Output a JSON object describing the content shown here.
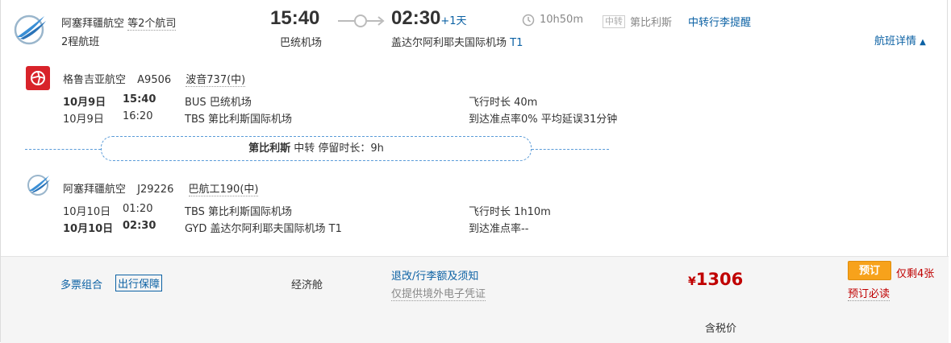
{
  "header": {
    "airline": "阿塞拜疆航空",
    "carriers_note": "等2个航司",
    "trip_type": "2程航班",
    "dep_time": "15:40",
    "dep_airport": "巴统机场",
    "arr_time": "02:30",
    "arr_day_offset": "+1天",
    "arr_airport": "盖达尔阿利耶夫国际机场",
    "arr_terminal": "T1",
    "duration": "10h50m",
    "transfer_badge": "中转",
    "transfer_city": "第比利斯",
    "baggage_tip": "中转行李提醒",
    "details_link": "航班详情"
  },
  "segments": [
    {
      "airline": "格鲁吉亚航空",
      "flight_no": "A9506",
      "aircraft": "波音737(中)",
      "dep_date": "10月9日",
      "dep_time": "15:40",
      "dep_airport": "BUS 巴统机场",
      "arr_date": "10月9日",
      "arr_time": "16:20",
      "arr_airport": "TBS 第比利斯国际机场",
      "flight_time": "飞行时长 40m",
      "punctuality": "到达准点率0% 平均延误31分钟",
      "brand_color": "#d8232a"
    },
    {
      "airline": "阿塞拜疆航空",
      "flight_no": "J29226",
      "aircraft": "巴航工190(中)",
      "dep_date": "10月10日",
      "dep_time": "01:20",
      "dep_airport": "TBS 第比利斯国际机场",
      "arr_date": "10月10日",
      "arr_time": "02:30",
      "arr_airport": "GYD 盖达尔阿利耶夫国际机场 T1",
      "flight_time": "飞行时长 1h10m",
      "punctuality": "到达准点率--",
      "brand_color": "#3a8fd6"
    }
  ],
  "layover": {
    "city": "第比利斯",
    "text": "中转 停留时长：9h"
  },
  "footer": {
    "combo_label": "多票组合",
    "guarantee_label": "出行保障",
    "cabin": "经济舱",
    "refund_rules": "退改/行李额及须知",
    "ticket_note": "仅提供境外电子凭证",
    "currency": "¥",
    "price": "1306",
    "tax_note": "含税价",
    "book_label": "预订",
    "remaining": "仅剩4张",
    "must_read": "预订必读"
  },
  "colors": {
    "link_blue": "#0b61a4",
    "price_red": "#c00000",
    "book_orange": "#f7a21b"
  }
}
